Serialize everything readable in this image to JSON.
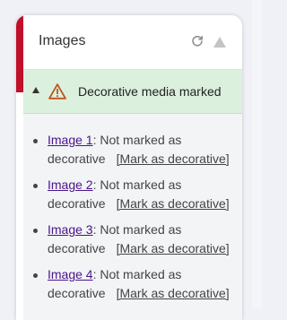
{
  "panel": {
    "title": "Images",
    "refresh_icon": "refresh-icon",
    "collapse_icon": "triangle-up-icon"
  },
  "section": {
    "label": "Decorative media marked",
    "status_icon": "warning-triangle-icon",
    "colors": {
      "background": "#dcf0de",
      "icon": "#c0541f",
      "accent": "#c0102a"
    }
  },
  "issues": [
    {
      "link": "Image 1",
      "text": ": Not marked as",
      "text2": "decorative",
      "action": "[Mark as decorative]"
    },
    {
      "link": "Image 2",
      "text": ": Not marked as",
      "text2": "decorative",
      "action": "[Mark as decorative]"
    },
    {
      "link": "Image 3",
      "text": ": Not marked as",
      "text2": "decorative",
      "action": "[Mark as decorative]"
    },
    {
      "link": "Image 4",
      "text": ": Not marked as",
      "text2": "decorative",
      "action": "[Mark as decorative]"
    }
  ]
}
